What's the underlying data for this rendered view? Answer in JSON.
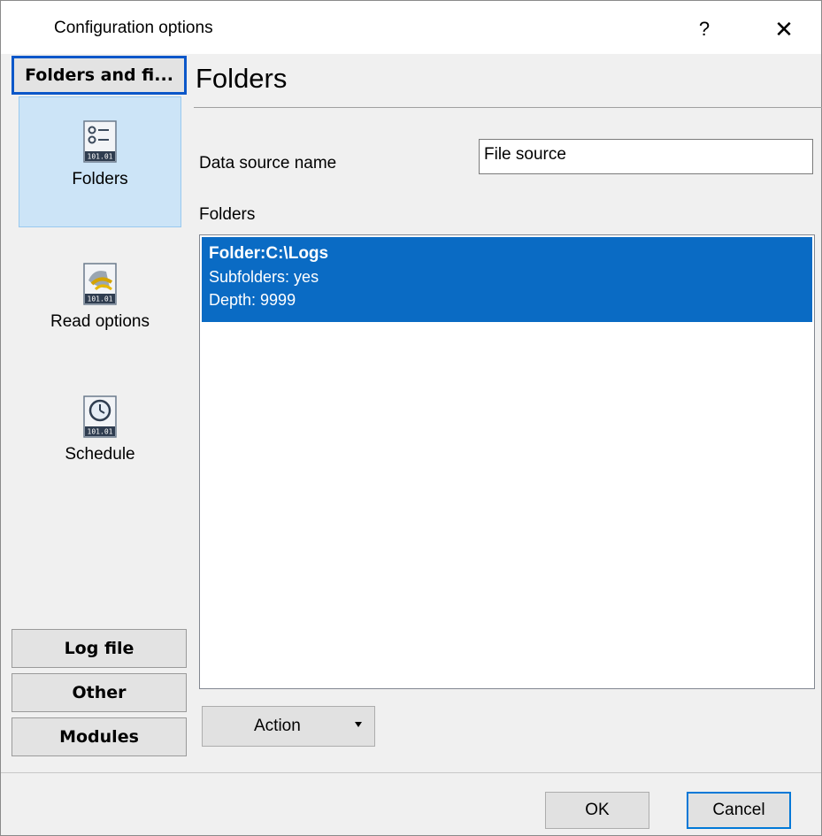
{
  "window": {
    "title": "Configuration options",
    "help_glyph": "?",
    "close_glyph": "✕"
  },
  "nav": {
    "groups": [
      {
        "label": "Folders and fi...",
        "active": true
      },
      {
        "label": "Log file"
      },
      {
        "label": "Other"
      },
      {
        "label": "Modules"
      }
    ],
    "items": [
      {
        "label": "Folders",
        "icon": "folders-options-icon",
        "selected": true
      },
      {
        "label": "Read options",
        "icon": "read-options-icon"
      },
      {
        "label": "Schedule",
        "icon": "schedule-clock-icon"
      }
    ]
  },
  "main": {
    "page_title": "Folders",
    "data_source_label": "Data source name",
    "data_source_value": "File source",
    "folders_label": "Folders",
    "folder_list": [
      {
        "title": "Folder:C:\\Logs",
        "lines": [
          "Subfolders: yes",
          "Depth: 9999"
        ],
        "selected": true
      }
    ],
    "action_label": "Action"
  },
  "footer": {
    "ok_label": "OK",
    "cancel_label": "Cancel"
  },
  "colors": {
    "selection": "#0a6bc4",
    "nav_selected_bg": "#cce4f7",
    "focus_border": "#0078d7"
  }
}
